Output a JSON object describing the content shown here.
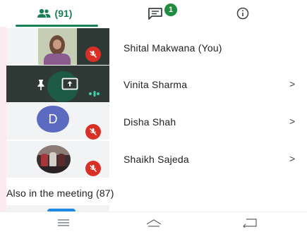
{
  "header": {
    "participants_count": "(91)",
    "chat_badge": "1",
    "tabs": [
      "people-tab",
      "chat-tab",
      "info-tab"
    ]
  },
  "participants": [
    {
      "name": "Shital Makwana (You)",
      "muted": true,
      "has_chevron": false
    },
    {
      "name": "Vinita Sharma",
      "muted": false,
      "presenting": true,
      "pinned": true,
      "has_chevron": true,
      "chevron": ">"
    },
    {
      "name": "Disha Shah",
      "muted": true,
      "avatar_letter": "D",
      "has_chevron": true,
      "chevron": ">"
    },
    {
      "name": "Shaikh Sajeda",
      "muted": true,
      "has_chevron": true,
      "chevron": ">"
    }
  ],
  "section": {
    "also_in_meeting": "Also in the meeting (87)"
  },
  "colors": {
    "accent_green": "#1a7f55",
    "badge_green": "#1e8e3e",
    "mute_red": "#d93025",
    "avatar_blue": "#5c6bc0",
    "tile_dark": "#2f3a36"
  },
  "icons": [
    "people-icon",
    "chat-icon",
    "info-icon",
    "mic-off-icon",
    "pin-icon",
    "present-icon",
    "audio-level-icon",
    "menu-icon",
    "home-icon",
    "back-icon"
  ]
}
